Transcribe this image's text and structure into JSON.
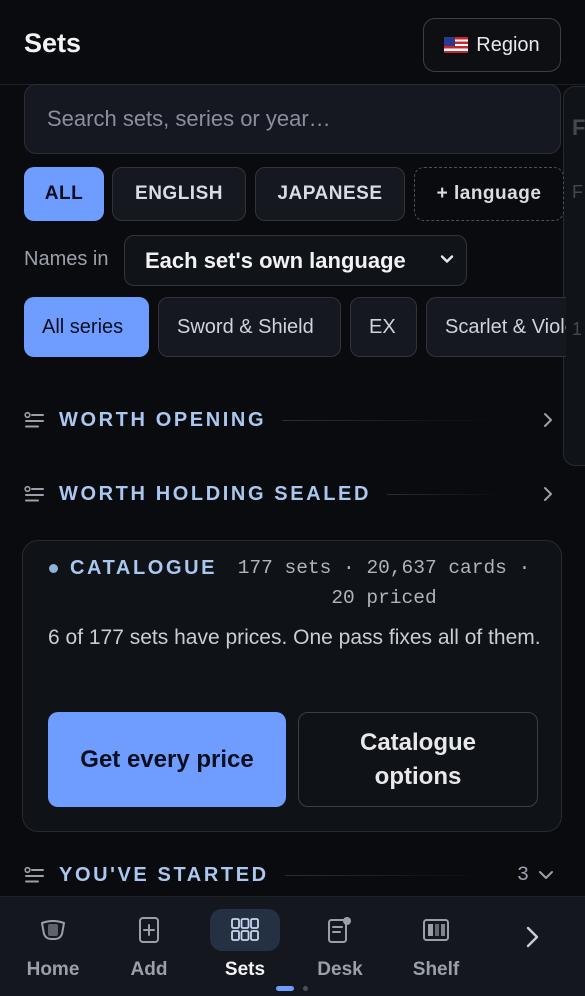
{
  "header": {
    "title": "Sets",
    "region_label": "Region"
  },
  "search": {
    "placeholder": "Search sets, series or year…"
  },
  "language_filters": [
    "ALL",
    "ENGLISH",
    "JAPANESE",
    "+ language"
  ],
  "names_in": {
    "label": "Names in",
    "selected": "Each set's own language"
  },
  "series_filters": [
    "All series",
    "Sword & Shield",
    "EX",
    "Scarlet & Violet"
  ],
  "sections": {
    "worth_opening": "WORTH OPENING",
    "worth_holding": "WORTH HOLDING SEALED",
    "started": "YOU'VE STARTED",
    "started_count": "3"
  },
  "catalogue": {
    "title": "CATALOGUE",
    "meta_line1": "177 sets · 20,637 cards ·",
    "meta_line2": "20 priced",
    "description": "6 of 177 sets have prices. One pass fixes all of them.",
    "primary_button": "Get every price",
    "secondary_button": "Catalogue options"
  },
  "bottom_nav": [
    "Home",
    "Add",
    "Sets",
    "Desk",
    "Shelf"
  ],
  "colors": {
    "accent": "#6f9cff",
    "section_title": "#a9c7ef",
    "background": "#0a0b0e"
  }
}
